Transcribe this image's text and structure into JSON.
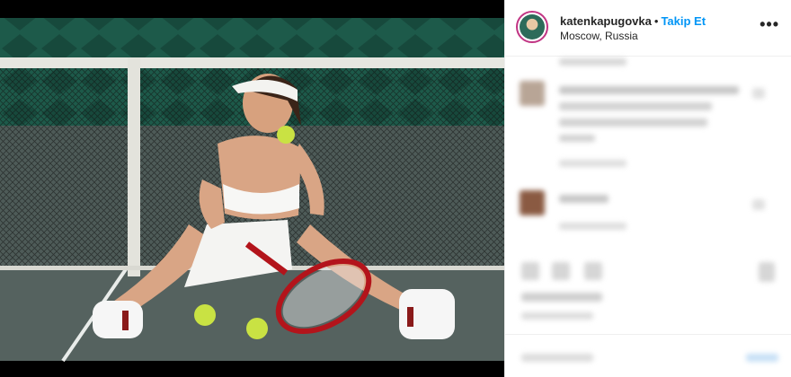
{
  "post": {
    "username": "katenkapugovka",
    "separator": "•",
    "follow_label": "Takip Et",
    "location": "Moscow, Russia",
    "more_icon": "more-horizontal-icon"
  },
  "colors": {
    "follow": "#0095f6",
    "text": "#262626",
    "court_green": "#1e5b4b",
    "court_floor": "#55625f"
  }
}
